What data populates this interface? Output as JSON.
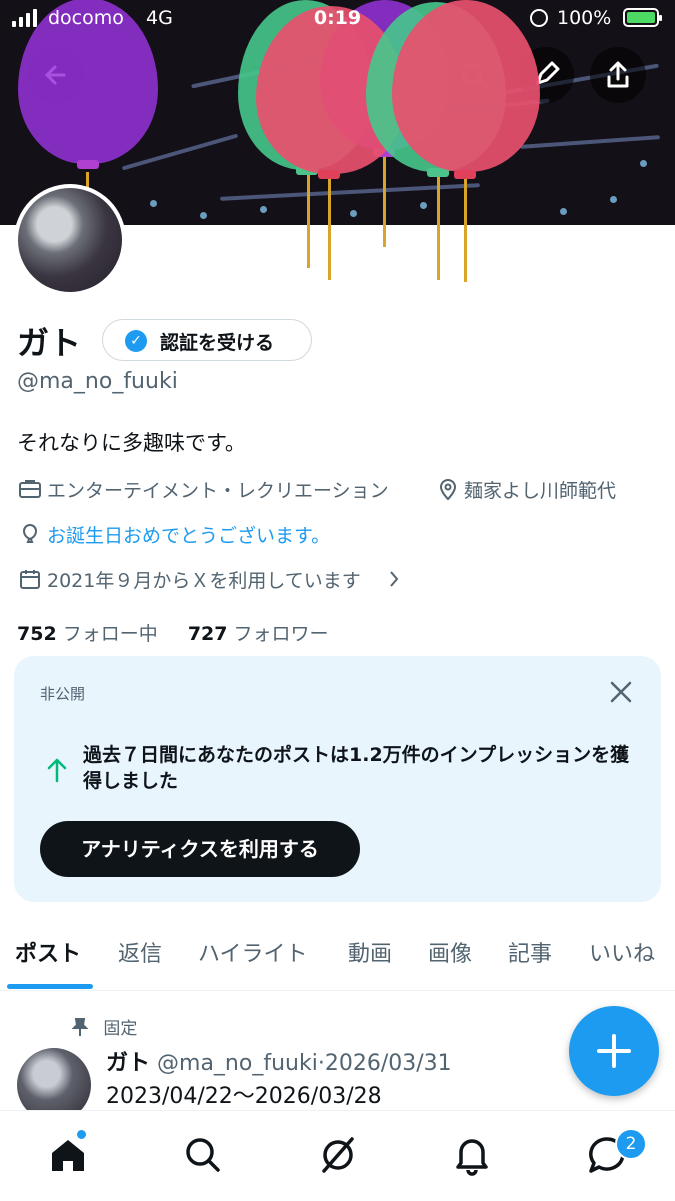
{
  "status_bar": {
    "carrier": "docomo",
    "network": "4G",
    "time": "0:19",
    "battery": "100%"
  },
  "header": {
    "back_icon": "arrow-left-icon",
    "search_icon": "search-icon",
    "edit_icon": "pencil-icon",
    "share_icon": "share-icon"
  },
  "profile": {
    "name": "ガト",
    "verify_button": "認証を受ける",
    "handle": "@ma_no_fuuki",
    "bio": "それなりに多趣味です。",
    "category": "エンターテイメント・レクリエーション",
    "location": "麺家よし川師範代",
    "birthday": "お誕生日おめでとうございます。",
    "joined": "2021年９月からＸを利用しています",
    "following_count": "752",
    "following_label": "フォロー中",
    "followers_count": "727",
    "followers_label": "フォロワー"
  },
  "private_card": {
    "tag": "非公開",
    "message": "過去７日間にあなたのポストは1.2万件のインプレッションを獲得しました",
    "cta": "アナリティクスを利用する"
  },
  "tabs": [
    "ポスト",
    "返信",
    "ハイライト",
    "動画",
    "画像",
    "記事",
    "いいね"
  ],
  "post": {
    "pinned_label": "固定",
    "author": "ガト",
    "handle": "@ma_no_fuuki",
    "separator": "·",
    "date": "2026/03/31",
    "text": "2023/04/22〜2026/03/28"
  },
  "bottom_nav": {
    "items": [
      "home-icon",
      "search-icon",
      "grok-icon",
      "bell-icon",
      "messages-icon"
    ],
    "messages_badge": "2"
  },
  "colors": {
    "accent": "#1d9bf0",
    "card_bg": "#e8f5fd",
    "text_secondary": "#536471"
  }
}
